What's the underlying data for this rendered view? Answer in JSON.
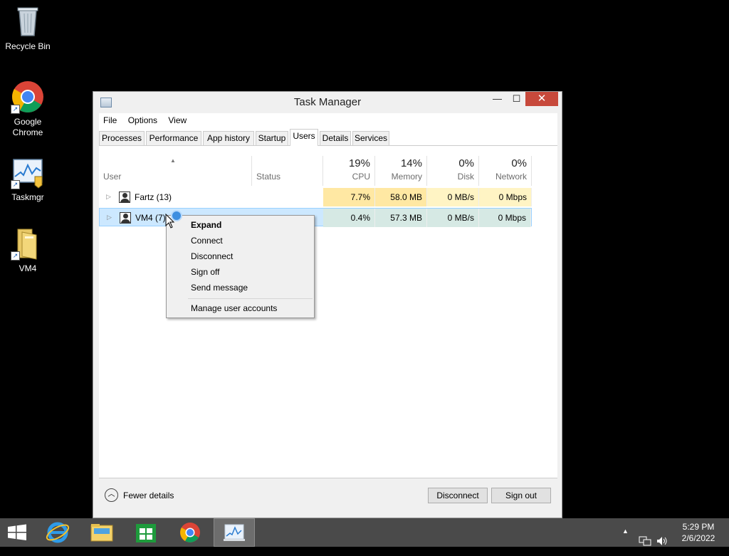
{
  "desktop": {
    "icons": [
      {
        "label": "Recycle Bin"
      },
      {
        "label": "Google Chrome"
      },
      {
        "label": "Taskmgr"
      },
      {
        "label": "VM4"
      }
    ]
  },
  "window": {
    "title": "Task Manager",
    "minimize": "—",
    "maximize": "☐",
    "close": "✕"
  },
  "menu": [
    "File",
    "Options",
    "View"
  ],
  "tabs": [
    "Processes",
    "Performance",
    "App history",
    "Startup",
    "Users",
    "Details",
    "Services"
  ],
  "active_tab": "Users",
  "columns": {
    "user": "User",
    "status": "Status",
    "cpu": {
      "pct": "19%",
      "name": "CPU"
    },
    "memory": {
      "pct": "14%",
      "name": "Memory"
    },
    "disk": {
      "pct": "0%",
      "name": "Disk"
    },
    "network": {
      "pct": "0%",
      "name": "Network"
    }
  },
  "rows": [
    {
      "user": "Fartz (13)",
      "status": "",
      "cpu": "7.7%",
      "memory": "58.0 MB",
      "disk": "0 MB/s",
      "network": "0 Mbps"
    },
    {
      "user": "VM4 (7)",
      "status": "",
      "cpu": "0.4%",
      "memory": "57.3 MB",
      "disk": "0 MB/s",
      "network": "0 Mbps"
    }
  ],
  "context_menu": [
    "Expand",
    "Connect",
    "Disconnect",
    "Sign off",
    "Send message",
    "Manage user accounts"
  ],
  "footer": {
    "fewer_details": "Fewer details",
    "disconnect": "Disconnect",
    "sign_out": "Sign out"
  },
  "taskbar": {
    "items": [
      "start-icon",
      "internet-explorer-icon",
      "file-explorer-icon",
      "store-icon",
      "chrome-icon",
      "task-manager-icon"
    ],
    "time": "5:29 PM",
    "date": "2/6/2022"
  }
}
